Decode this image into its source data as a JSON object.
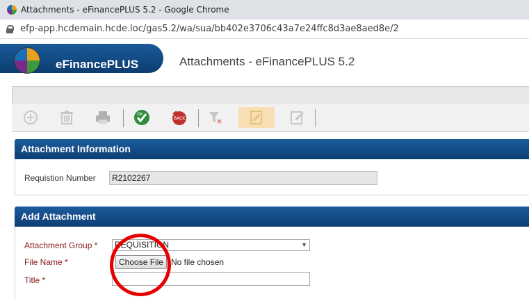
{
  "browser": {
    "tab_title": "Attachments - eFinancePLUS 5.2 - Google Chrome",
    "url": "efp-app.hcdemain.hcde.loc/gas5.2/wa/sua/bb402e3706c43a7e24ffc8d3ae8aed8e/2"
  },
  "app": {
    "brand": "eFinancePLUS",
    "page_title": "Attachments - eFinancePLUS 5.2"
  },
  "toolbar": {
    "buttons": [
      "add-icon",
      "delete-icon",
      "print-icon",
      "ok-icon",
      "back-icon",
      "clear-filter-icon",
      "notes-icon",
      "edit-notes-icon"
    ],
    "ok_label": "OK",
    "back_label": "BACK"
  },
  "attachment_info": {
    "header": "Attachment Information",
    "requisition_label": "Requistion Number",
    "requisition_value": "R2102267"
  },
  "add_attachment": {
    "header": "Add Attachment",
    "group_label": "Attachment Group *",
    "group_value": "REQUISITION",
    "file_label": "File Name *",
    "choose_file_button": "Choose File",
    "no_file_text": "No file chosen",
    "title_label": "Title *",
    "title_value": ""
  },
  "colors": {
    "header_blue": "#0d3e75",
    "required_label": "#8b1a1a",
    "annotation_circle": "#e60000"
  }
}
